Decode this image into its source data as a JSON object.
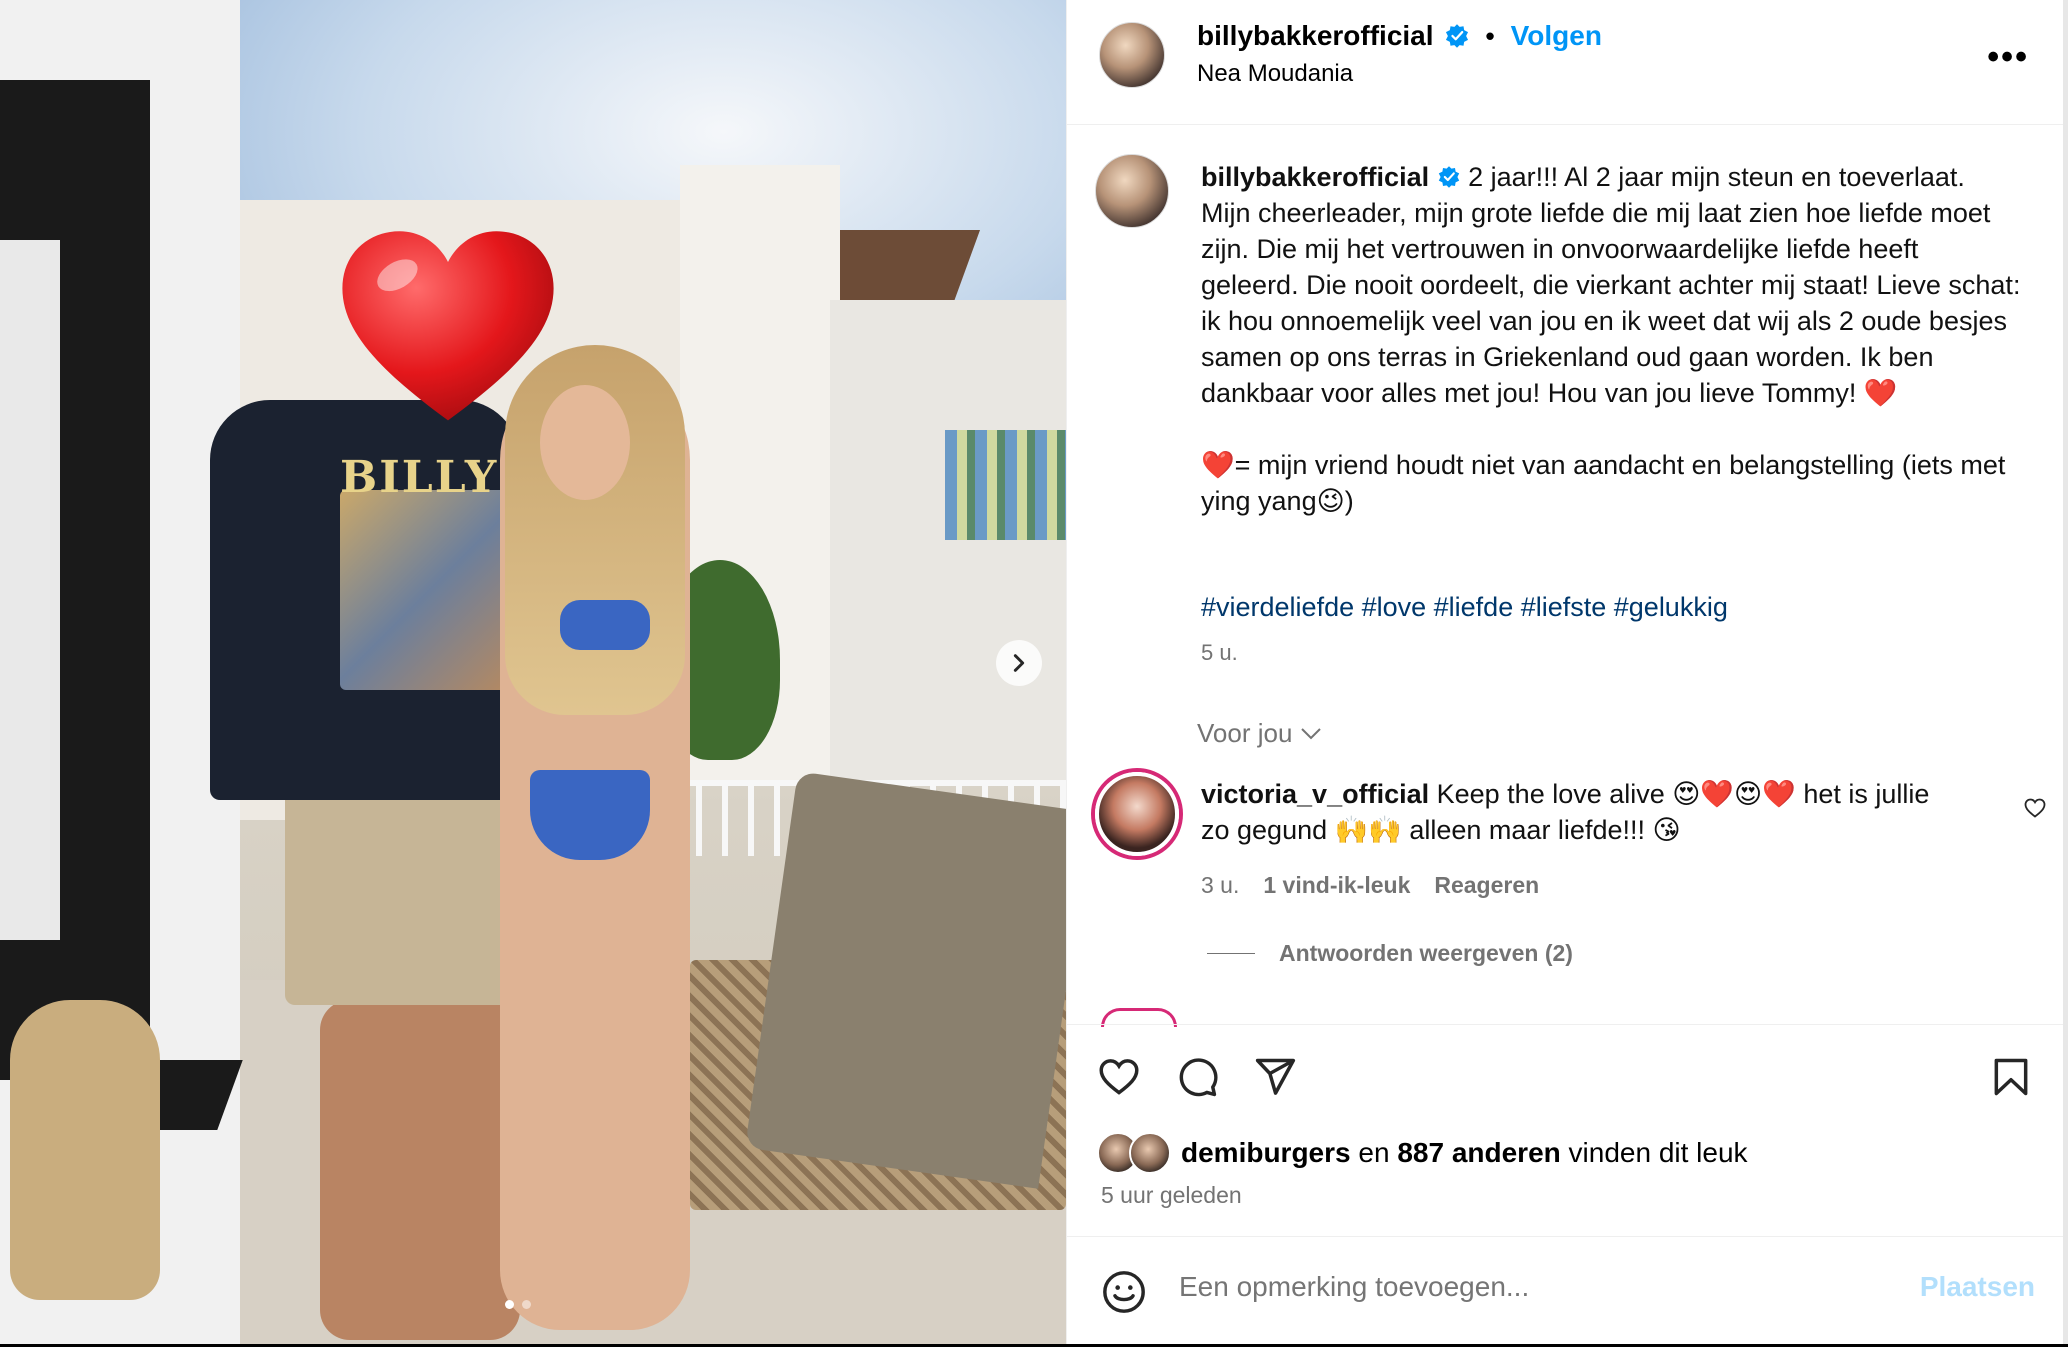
{
  "post": {
    "username": "billybakkerofficial",
    "follow_label": "Volgen",
    "separator": "•",
    "location": "Nea Moudania",
    "more_label": "•••",
    "shirt_text": "BILLY"
  },
  "caption": {
    "username": "billybakkerofficial",
    "text": "2 jaar!!! Al 2 jaar mijn steun en toeverlaat. Mijn cheerleader, mijn grote liefde die mij laat zien hoe liefde moet zijn. Die mij het vertrouwen in onvoorwaardelijke liefde heeft geleerd. Die nooit oordeelt, die vierkant achter mij staat! Lieve schat: ik hou onnoemelijk veel van jou en ik weet dat wij als 2 oude besjes samen op ons terras in Griekenland oud gaan worden. Ik ben dankbaar voor alles met jou! Hou van jou lieve Tommy! ❤️\n\n❤️= mijn vriend houdt niet van aandacht en belangstelling (iets met ying yang😉)",
    "hashtags": "#vierdeliefde #love #liefde #liefste #gelukkig",
    "time": "5 u."
  },
  "section": {
    "for_you": "Voor jou"
  },
  "comment": {
    "username": "victoria_v_official",
    "text": "Keep the love alive 😍❤️😍❤️ het is jullie zo gegund 🙌🙌 alleen maar liefde!!! 😘",
    "time": "3 u.",
    "likes": "1 vind-ik-leuk",
    "reply": "Reageren",
    "view_replies": "Antwoorden weergeven (2)"
  },
  "likes": {
    "liker": "demiburgers",
    "and": "en",
    "others": "887 anderen",
    "suffix": "vinden dit leuk",
    "posted": "5 uur geleden"
  },
  "add_comment": {
    "placeholder": "Een opmerking toevoegen...",
    "post_label": "Plaatsen"
  },
  "carousel": {
    "slide_count": 2,
    "active_slide": 1
  },
  "colors": {
    "link": "#0095f6",
    "hashtag": "#00376b",
    "muted": "#737373",
    "verified": "#0095f6",
    "post_disabled": "#b2dffc"
  },
  "icons": [
    "verified-badge-icon",
    "more-options-icon",
    "chevron-down-icon",
    "heart-icon",
    "comment-icon",
    "share-icon",
    "bookmark-icon",
    "emoji-icon",
    "next-arrow-icon",
    "heart-sticker-icon"
  ]
}
